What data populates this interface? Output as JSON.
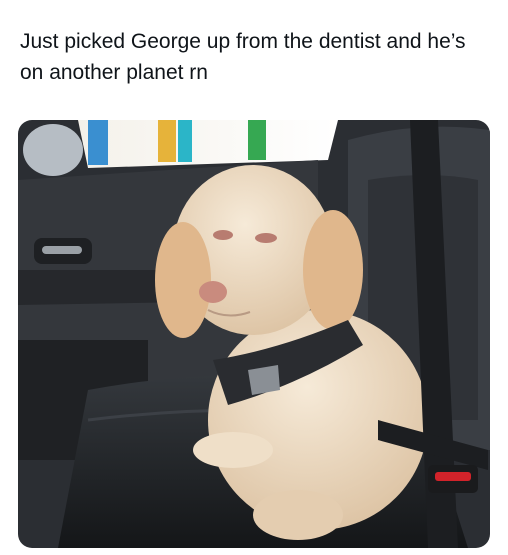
{
  "post": {
    "text": "Just picked George up from the dentist and he’s on another planet rn"
  },
  "media": {
    "type": "photo",
    "colors": {
      "car_interior": "#2b2e33",
      "seat": "#222528",
      "seatbelt": "#1c1e21",
      "dog_fur": "#e9d6bd",
      "dog_ears": "#e0b78c",
      "harness": "#2a2c30",
      "nose": "#c98b7e",
      "buckle_button": "#d2232a"
    }
  }
}
